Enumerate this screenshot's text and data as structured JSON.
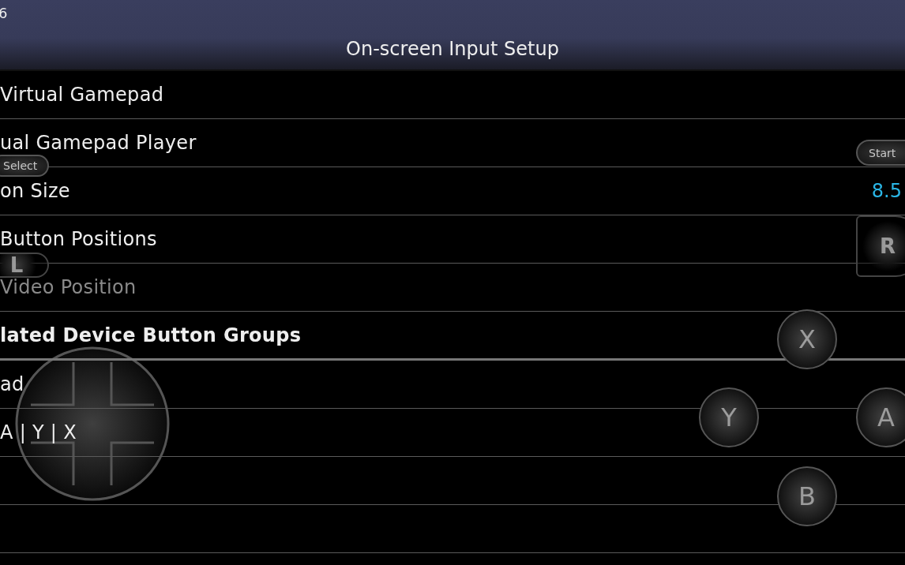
{
  "status_bar": {
    "text": "6"
  },
  "window": {
    "title": "On-screen Input Setup"
  },
  "rows": [
    {
      "kind": "setting",
      "label": "Virtual Gamepad",
      "disabled": false
    },
    {
      "kind": "setting",
      "label": "ual Gamepad Player",
      "disabled": false
    },
    {
      "kind": "setting",
      "label": "on Size",
      "value": "8.5",
      "disabled": false
    },
    {
      "kind": "setting",
      "label": "Button Positions",
      "disabled": false
    },
    {
      "kind": "setting",
      "label": "Video Position",
      "disabled": true
    },
    {
      "kind": "header",
      "label": "lated Device Button Groups"
    },
    {
      "kind": "setting",
      "label": "ad",
      "disabled": false
    },
    {
      "kind": "setting",
      "label": "A | Y | X",
      "disabled": false
    },
    {
      "kind": "empty"
    },
    {
      "kind": "empty"
    }
  ],
  "gamepad": {
    "buttons": [
      {
        "kind": "pill",
        "label": "Select"
      },
      {
        "kind": "pill",
        "label": "Start"
      },
      {
        "kind": "shoulder",
        "label": "L"
      },
      {
        "kind": "shoulder",
        "label": "R"
      },
      {
        "kind": "face",
        "label": "X"
      },
      {
        "kind": "face",
        "label": "Y"
      },
      {
        "kind": "face",
        "label": "A"
      },
      {
        "kind": "face",
        "label": "B"
      }
    ]
  }
}
